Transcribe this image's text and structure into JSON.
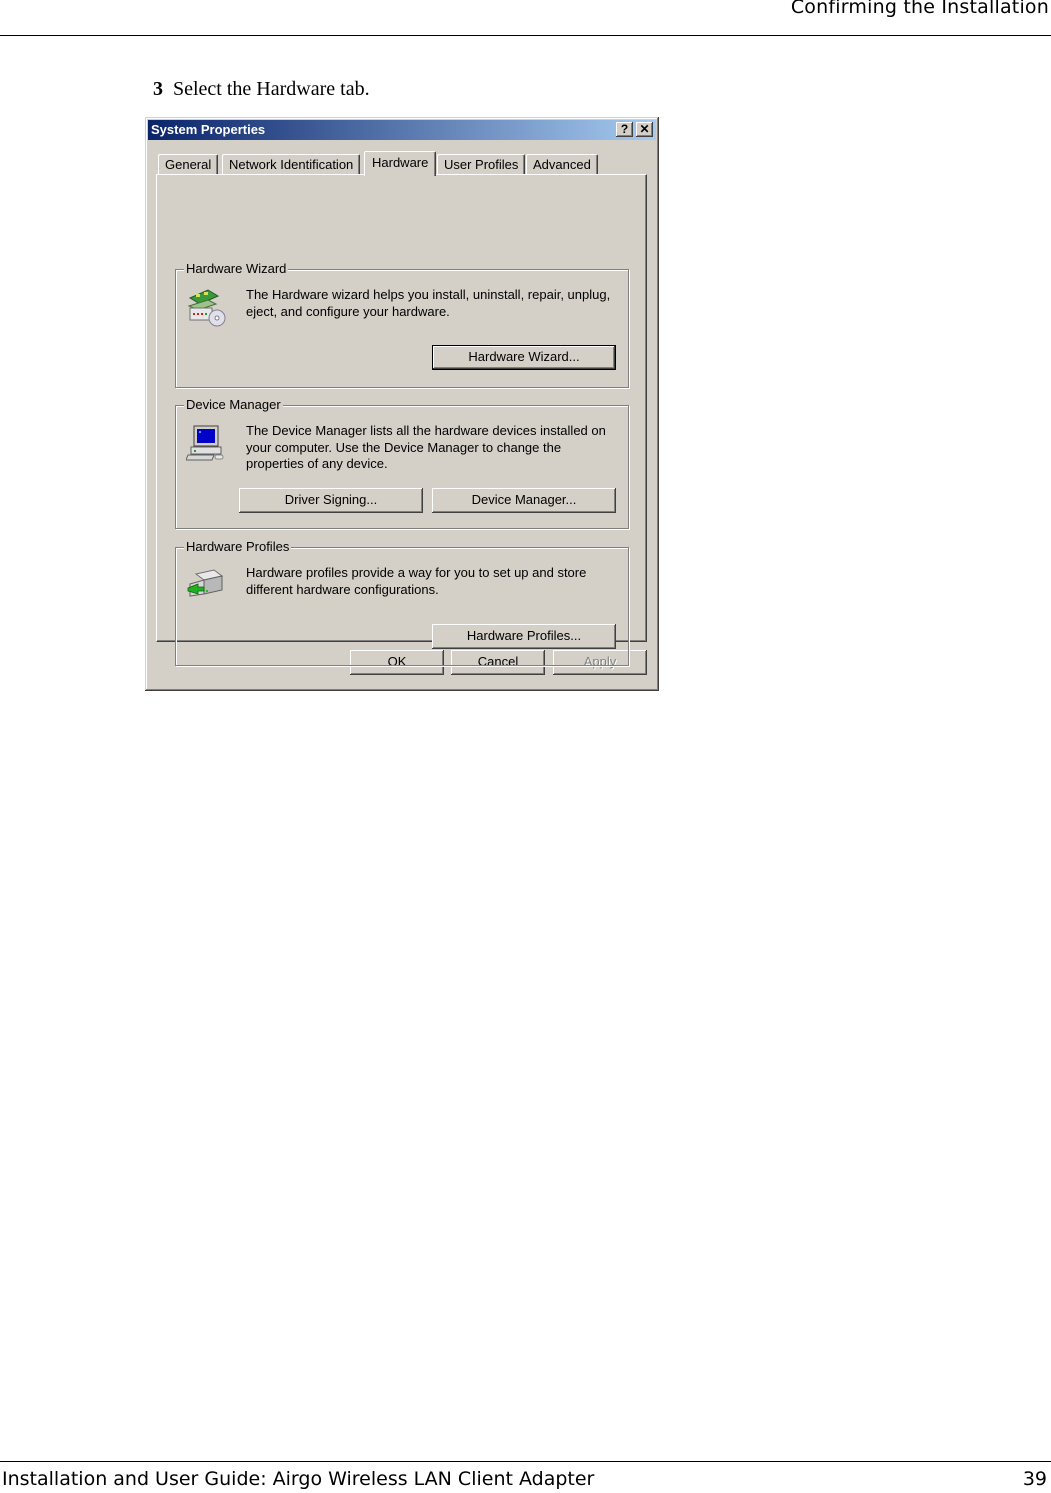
{
  "page": {
    "running_header": "Confirming the Installation",
    "step_number": "3",
    "step_text": "Select the Hardware tab.",
    "footer_title": "Installation and User Guide: Airgo Wireless LAN Client Adapter",
    "page_number": "39"
  },
  "dialog": {
    "title": "System Properties",
    "help_glyph": "?",
    "close_glyph": "✕",
    "tabs": [
      {
        "label": "General",
        "active": false
      },
      {
        "label": "Network Identification",
        "active": false
      },
      {
        "label": "Hardware",
        "active": true
      },
      {
        "label": "User Profiles",
        "active": false
      },
      {
        "label": "Advanced",
        "active": false
      }
    ],
    "groups": {
      "wizard": {
        "legend": "Hardware Wizard",
        "icon": "hardware-wizard-icon",
        "description": "The Hardware wizard helps you install, uninstall, repair, unplug, eject, and configure your hardware.",
        "button": "Hardware Wizard..."
      },
      "device_manager": {
        "legend": "Device Manager",
        "icon": "computer-icon",
        "description": "The Device Manager lists all the hardware devices installed on your computer. Use the Device Manager to change the properties of any device.",
        "buttons": [
          "Driver Signing...",
          "Device Manager..."
        ]
      },
      "profiles": {
        "legend": "Hardware Profiles",
        "icon": "hardware-profiles-icon",
        "description": "Hardware profiles provide a way for you to set up and store different hardware configurations.",
        "button": "Hardware Profiles..."
      }
    },
    "footer_buttons": {
      "ok": "OK",
      "cancel": "Cancel",
      "apply": "Apply",
      "apply_enabled": false
    },
    "colors": {
      "face": "#d4d0c8",
      "title_start": "#0a246a",
      "title_end": "#a6caf0"
    }
  }
}
